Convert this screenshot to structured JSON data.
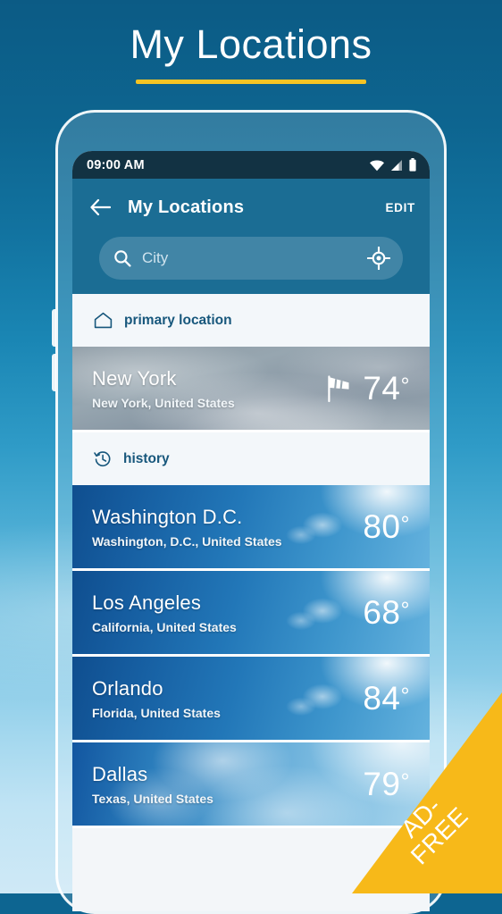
{
  "promo": {
    "title": "My Locations",
    "accent_color": "#f5c423",
    "background_top_color": "#0c5b85",
    "background_bottom_color": "#cfe9f6"
  },
  "ribbon": {
    "line1": "AD-",
    "line2": "FREE",
    "color": "#f7b919"
  },
  "status_bar": {
    "time": "09:00 AM",
    "icons": [
      "wifi-icon",
      "cellular-signal-icon",
      "battery-icon"
    ],
    "background_color": "#123243"
  },
  "app_bar": {
    "back_icon": "back-arrow-icon",
    "title": "My Locations",
    "edit_label": "EDIT",
    "background_color": "#1b6d94"
  },
  "search": {
    "icon": "search-icon",
    "placeholder": "City",
    "value": "",
    "gps_icon": "gps-crosshair-icon"
  },
  "sections": [
    {
      "id": "primary",
      "icon": "home-icon",
      "label": "primary location",
      "items": [
        {
          "name": "New York",
          "region": "New York, United States",
          "temperature": "74",
          "degree": "°",
          "weather_icon": "windsock-icon",
          "background": "cloudy"
        }
      ]
    },
    {
      "id": "history",
      "icon": "history-clock-icon",
      "label": "history",
      "items": [
        {
          "name": "Washington D.C.",
          "region": "Washington, D.C., United States",
          "temperature": "80",
          "degree": "°",
          "weather_icon": "",
          "background": "sunny"
        },
        {
          "name": "Los Angeles",
          "region": "California, United States",
          "temperature": "68",
          "degree": "°",
          "weather_icon": "",
          "background": "sunny"
        },
        {
          "name": "Orlando",
          "region": "Florida, United States",
          "temperature": "84",
          "degree": "°",
          "weather_icon": "",
          "background": "sunny"
        },
        {
          "name": "Dallas",
          "region": "Texas, United States",
          "temperature": "79",
          "degree": "°",
          "weather_icon": "",
          "background": "wispy"
        }
      ]
    }
  ]
}
